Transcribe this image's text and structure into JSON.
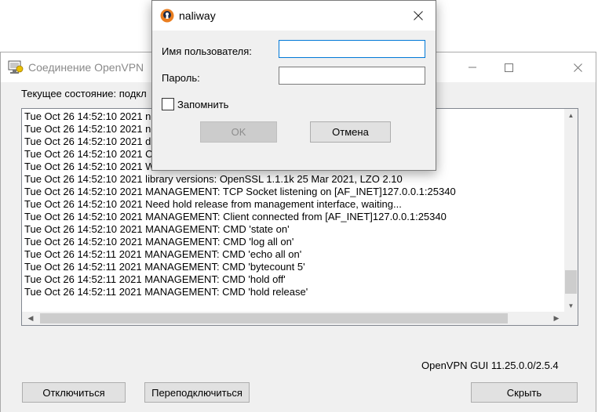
{
  "main_window": {
    "title": "Соединение OpenVPN",
    "status_label": "Текущее состояние: подкл",
    "log_lines": [
      "Tue Oct 26 14:52:10 2021  ne",
      "Tue Oct 26 14:52:10 2021  ne",
      "Tue Oct 26 14:52:10 2021  dh",
      "Tue Oct 26 14:52:10 2021 Op                                                                    PKCS11] [AEAD] built on Oc",
      "Tue Oct 26 14:52:10 2021 Wi",
      "Tue Oct 26 14:52:10 2021 library versions: OpenSSL 1.1.1k  25 Mar 2021, LZO 2.10",
      "Tue Oct 26 14:52:10 2021 MANAGEMENT: TCP Socket listening on [AF_INET]127.0.0.1:25340",
      "Tue Oct 26 14:52:10 2021 Need hold release from management interface, waiting...",
      "Tue Oct 26 14:52:10 2021 MANAGEMENT: Client connected from [AF_INET]127.0.0.1:25340",
      "Tue Oct 26 14:52:10 2021 MANAGEMENT: CMD 'state on'",
      "Tue Oct 26 14:52:10 2021 MANAGEMENT: CMD 'log all on'",
      "Tue Oct 26 14:52:11 2021 MANAGEMENT: CMD 'echo all on'",
      "Tue Oct 26 14:52:11 2021 MANAGEMENT: CMD 'bytecount 5'",
      "Tue Oct 26 14:52:11 2021 MANAGEMENT: CMD 'hold off'",
      "Tue Oct 26 14:52:11 2021 MANAGEMENT: CMD 'hold release'"
    ],
    "version_label": "OpenVPN GUI 11.25.0.0/2.5.4",
    "buttons": {
      "disconnect": "Отключиться",
      "reconnect": "Переподключиться",
      "hide": "Скрыть"
    }
  },
  "dialog": {
    "title": "naliway",
    "username_label": "Имя пользователя:",
    "username_value": "",
    "password_label": "Пароль:",
    "password_value": "",
    "remember_label": "Запомнить",
    "remember_checked": false,
    "ok_label": "OK",
    "cancel_label": "Отмена"
  },
  "icons": {
    "titlebar_main": "openvpn-monitor-icon",
    "titlebar_dialog": "openvpn-keyhole-icon",
    "minimize": "minimize-icon",
    "maximize": "maximize-icon",
    "close": "close-icon"
  },
  "colors": {
    "accent": "#0078d7",
    "openvpn_orange": "#ea7e20",
    "window_bg": "#f0f0f0",
    "disabled_button": "#cccccc"
  }
}
